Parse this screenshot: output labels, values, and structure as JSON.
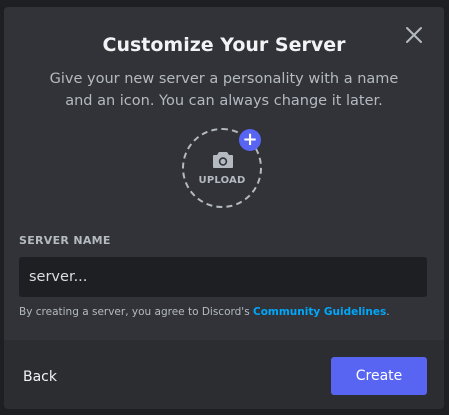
{
  "dialog": {
    "title": "Customize Your Server",
    "subtitle": "Give your new server a personality with a name and an icon. You can always change it later."
  },
  "upload": {
    "label": "UPLOAD",
    "plus": "+"
  },
  "server_name": {
    "label": "SERVER NAME",
    "value": "server..."
  },
  "terms": {
    "prefix": "By creating a server, you agree to Discord's ",
    "link": "Community Guidelines",
    "suffix": "."
  },
  "footer": {
    "back_label": "Back",
    "create_label": "Create"
  },
  "colors": {
    "modal_bg": "#313338",
    "footer_bg": "#2b2d31",
    "accent": "#5865f2",
    "link": "#00a8fc",
    "input_bg": "#1e1f22"
  },
  "icons": {
    "close": "close-icon",
    "camera": "camera-icon",
    "plus": "plus-icon"
  }
}
